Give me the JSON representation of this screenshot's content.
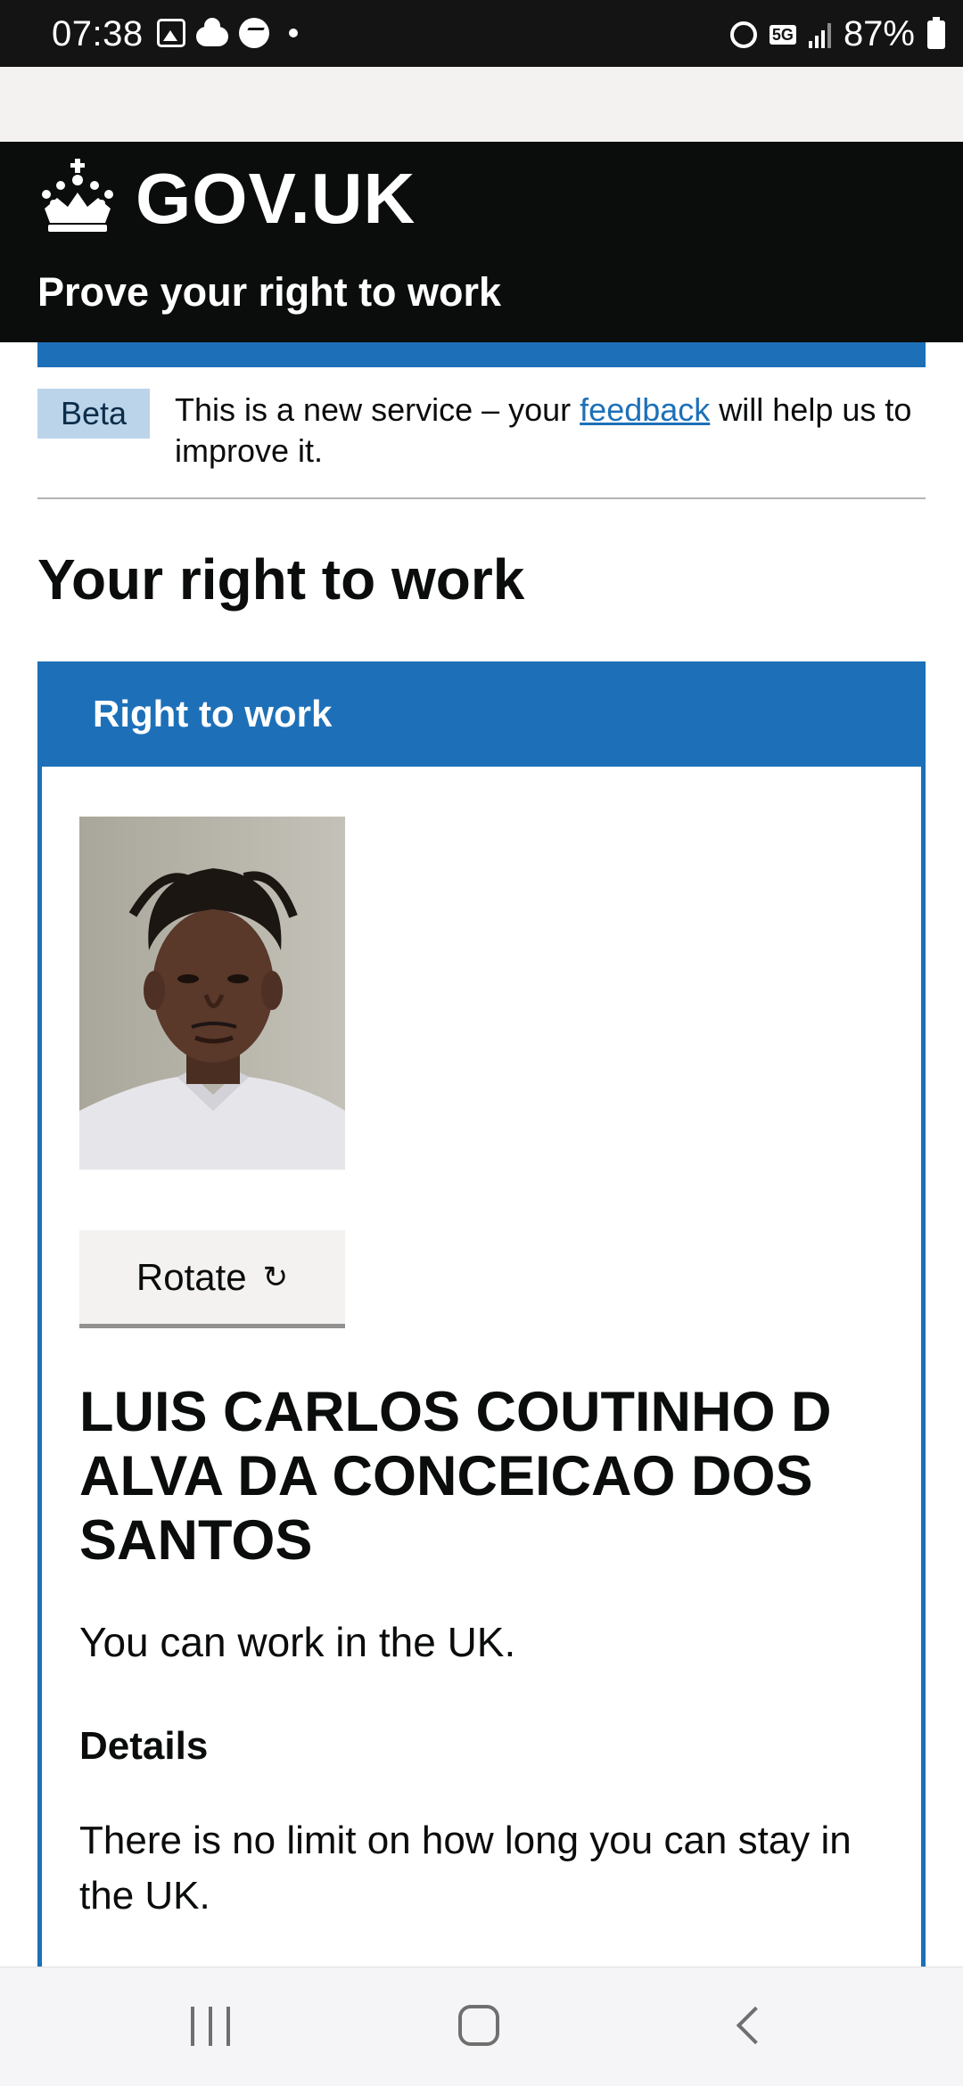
{
  "status_bar": {
    "time": "07:38",
    "network": "5G",
    "battery": "87%"
  },
  "header": {
    "logotype": "GOV.UK",
    "service_name": "Prove your right to work"
  },
  "phase_banner": {
    "tag": "Beta",
    "text_before": "This is a new service – your ",
    "link_text": "feedback",
    "text_after": " will help us to improve it."
  },
  "page": {
    "heading": "Your right to work"
  },
  "card": {
    "title": "Right to work",
    "photo_alt": "Photo of the person",
    "rotate_label": "Rotate",
    "rotate_icon": "↻",
    "name": "LUIS CARLOS COUTINHO D ALVA DA CONCEICAO DOS SANTOS",
    "status": "You can work in the UK.",
    "details_heading": "Details",
    "details_text": "There is no limit on how long you can stay in the UK."
  }
}
